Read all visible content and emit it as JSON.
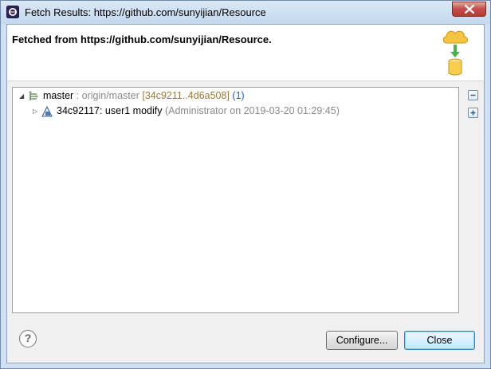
{
  "window": {
    "title": "Fetch Results: https://github.com/sunyijian/Resource"
  },
  "banner": {
    "message": "Fetched from https://github.com/sunyijian/Resource."
  },
  "tree": {
    "ref": {
      "name": "master",
      "mapping": " : origin/master ",
      "range": "[34c9211..4d6a508]",
      "count": " (1)",
      "expanded": true
    },
    "commit": {
      "id_message": "34c92117: user1 modify",
      "meta": " (Administrator on 2019-03-20 01:29:45)",
      "expanded": false
    }
  },
  "buttons": {
    "configure": "Configure...",
    "close": "Close",
    "help": "?"
  },
  "icons": {
    "app": "eclipse-icon",
    "banner": "cloud-fetch-icon",
    "ref": "branch-ref-icon",
    "commit": "commit-icon",
    "collapse": "collapse-all-icon",
    "expand": "expand-all-icon",
    "help": "help-icon",
    "window_close": "close-icon"
  }
}
